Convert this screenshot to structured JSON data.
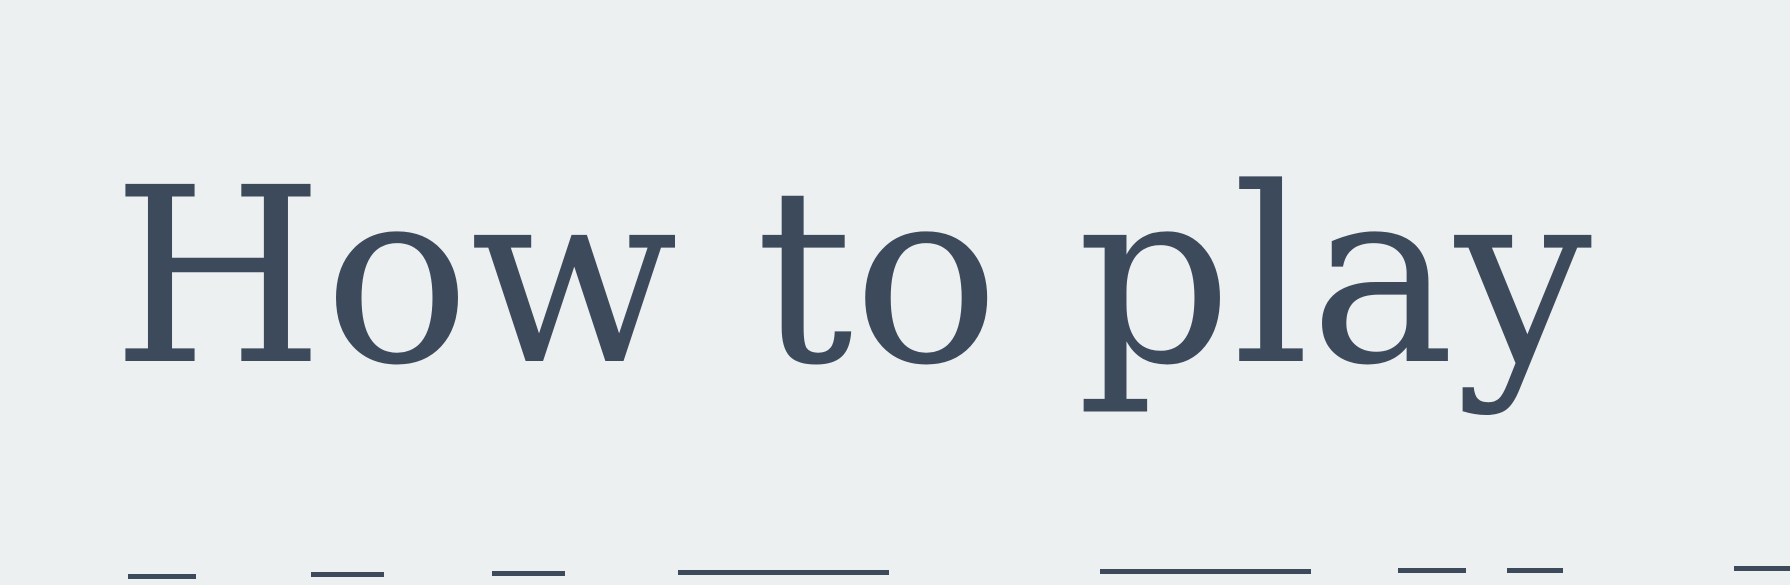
{
  "title": "How to play",
  "colors": {
    "background": "#ecf0f1",
    "text": "#3d4a5c"
  }
}
